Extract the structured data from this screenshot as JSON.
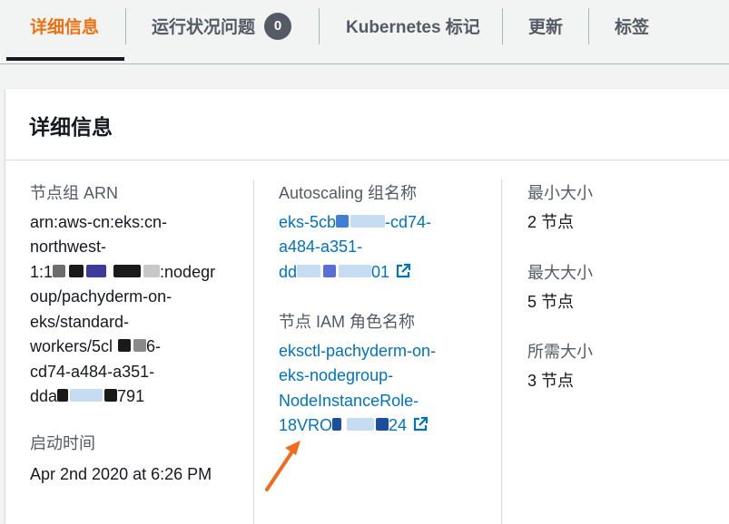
{
  "tabs": {
    "details": "详细信息",
    "health": "运行状况问题",
    "health_count": "0",
    "kubernetes": "Kubernetes 标记",
    "updates": "更新",
    "tags": "标签"
  },
  "card": {
    "title": "详细信息"
  },
  "fields": {
    "arn_label": "节点组 ARN",
    "arn_line1": "arn:aws-cn:eks:cn-",
    "arn_line2": "northwest-",
    "arn_line3_prefix": "1:1",
    "arn_line3_suffix": ":nodegr",
    "arn_line4": "oup/pachyderm-on-",
    "arn_line5": "eks/standard-",
    "arn_line6_prefix": "workers/5cl",
    "arn_line6_suffix": "6-",
    "arn_line7": "cd74-a484-a351-",
    "arn_line8_prefix": "dda",
    "arn_line8_suffix": "791",
    "created_label": "启动时间",
    "created_value": "Apr 2nd 2020 at 6:26 PM",
    "asg_label": "Autoscaling 组名称",
    "asg_line1_prefix": "eks-5cb",
    "asg_line1_suffix": "-cd74-",
    "asg_line2": "a484-a351-",
    "asg_line3_prefix": "dd",
    "asg_line3_suffix": "01",
    "role_label": "节点 IAM 角色名称",
    "role_line1": "eksctl-pachyderm-on-",
    "role_line2": "eks-nodegroup-",
    "role_line3": "NodeInstanceRole-",
    "role_line4_prefix": "18VRO",
    "role_line4_suffix": "24",
    "min_label": "最小大小",
    "min_value": "2 节点",
    "max_label": "最大大小",
    "max_value": "5 节点",
    "desired_label": "所需大小",
    "desired_value": "3 节点"
  },
  "colors": {
    "active_tab": "#ec7211",
    "link": "#0073bb",
    "annotation_arrow": "#f26a1b"
  }
}
